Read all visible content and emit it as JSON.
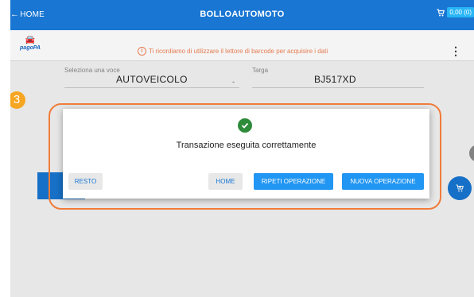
{
  "header": {
    "home_label": "HOME",
    "title": "BOLLOAUTOMOTO",
    "cart_badge": "0,00 (0)"
  },
  "subbar": {
    "logo_text": "pagoPA",
    "notice": "Ti ricordiamo di utilizzare il lettore di barcode per acquisire i dati"
  },
  "form": {
    "voce_label": "Seleziona una voce",
    "voce_value": "AUTOVEICOLO",
    "caret": "-",
    "targa_label": "Targa",
    "targa_value": "BJ517XD"
  },
  "step_badge": "3",
  "dialog": {
    "message": "Transazione eseguita correttamente",
    "buttons": {
      "resto": "RESTO",
      "home": "HOME",
      "ripeti": "RIPETI OPERAZIONE",
      "nuova": "NUOVA OPERAZIONE"
    }
  },
  "colors": {
    "primary": "#1976d2",
    "action": "#2196f3",
    "success": "#2e8b3a",
    "highlight": "#f07c3a",
    "step_badge": "#f6a623",
    "notice": "#e57c52"
  },
  "icons": {
    "back": "arrow-left-icon",
    "cart": "cart-icon",
    "info": "info-icon",
    "check": "check-circle-icon",
    "menu": "kebab-menu-icon",
    "fab": "add-cart-icon"
  }
}
